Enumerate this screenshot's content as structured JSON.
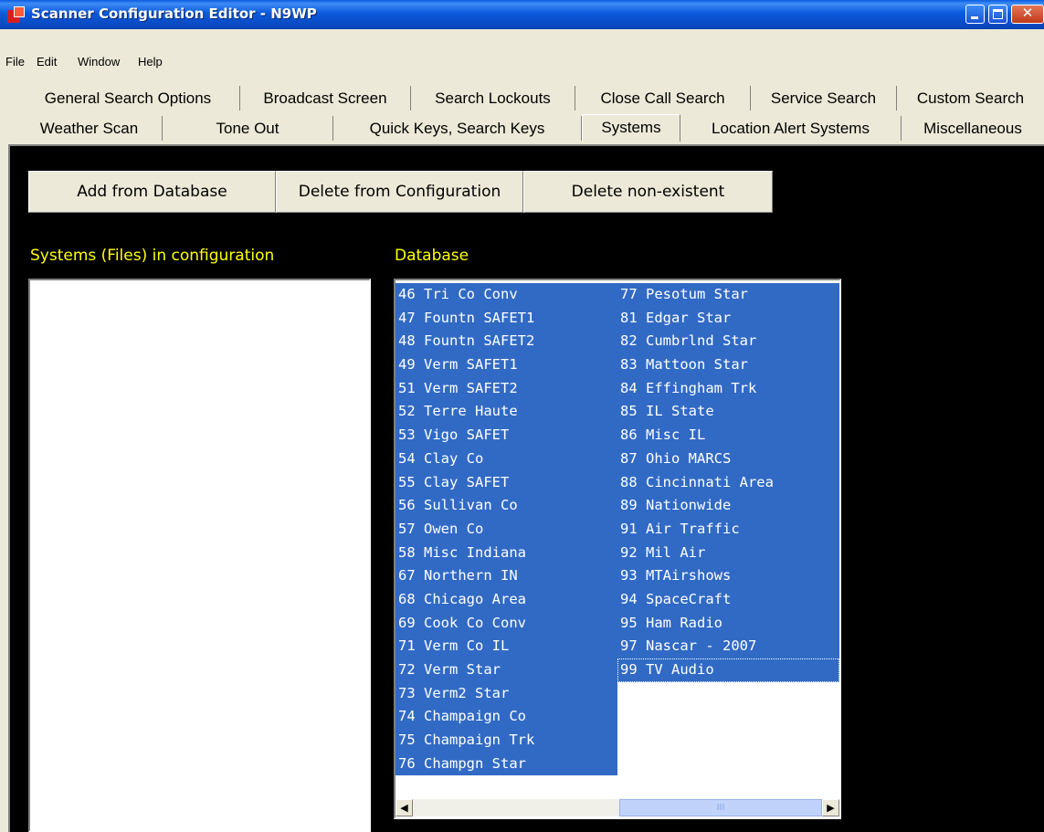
{
  "window": {
    "title": "Scanner Configuration Editor - N9WP",
    "minimize": "",
    "maximize": "",
    "close": "✕"
  },
  "menu": [
    "File",
    "Edit",
    "Window",
    "Help"
  ],
  "tabs_row1": [
    "General Search Options",
    "Broadcast Screen",
    "Search Lockouts",
    "Close Call Search",
    "Service Search",
    "Custom Search"
  ],
  "tabs_row2": [
    "Weather Scan",
    "Tone Out",
    "Quick Keys, Search Keys",
    "Systems",
    "Location Alert Systems",
    "Miscellaneous"
  ],
  "selected_tab": "Systems",
  "buttons": {
    "add": "Add from Database",
    "delete_config": "Delete from Configuration",
    "delete_nonexistent": "Delete non-existent"
  },
  "labels": {
    "systems_in_config": "Systems (Files) in configuration",
    "database": "Database"
  },
  "database_col1": [
    "46 Tri Co Conv",
    "47 Fountn SAFET1",
    "48 Fountn SAFET2",
    "49 Verm SAFET1",
    "51 Verm SAFET2",
    "52 Terre Haute",
    "53 Vigo SAFET",
    "54 Clay Co",
    "55 Clay SAFET",
    "56 Sullivan Co",
    "57 Owen Co",
    "58 Misc Indiana",
    "67 Northern IN",
    "68 Chicago Area",
    "69 Cook Co Conv",
    "71 Verm Co IL",
    "72 Verm Star",
    "73 Verm2 Star",
    "74 Champaign Co",
    "75 Champaign Trk",
    "76 Champgn Star"
  ],
  "database_col2": [
    "77 Pesotum Star",
    "81 Edgar Star",
    "82 Cumbrlnd Star",
    "83 Mattoon Star",
    "84 Effingham Trk",
    "85 IL State",
    "86 Misc IL",
    "87 Ohio MARCS",
    "88 Cincinnati Area",
    "89 Nationwide",
    "91 Air Traffic",
    "92 Mil Air",
    "93 MTAirshows",
    "94 SpaceCraft",
    "95 Ham Radio",
    "97 Nascar - 2007",
    "99 TV Audio"
  ],
  "scrollbar": {
    "left": "◀",
    "right": "▶",
    "grip": "III"
  },
  "colors": {
    "titlebar": "#0A4CC6",
    "panel": "#000000",
    "label": "#FFFF00",
    "selection": "#316AC5",
    "chrome": "#ECE9D8"
  }
}
